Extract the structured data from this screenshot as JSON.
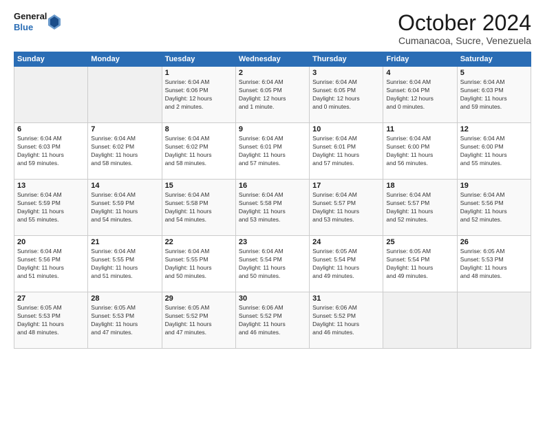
{
  "logo": {
    "general": "General",
    "blue": "Blue"
  },
  "title": "October 2024",
  "location": "Cumanacoa, Sucre, Venezuela",
  "days_header": [
    "Sunday",
    "Monday",
    "Tuesday",
    "Wednesday",
    "Thursday",
    "Friday",
    "Saturday"
  ],
  "weeks": [
    [
      {
        "day": "",
        "info": ""
      },
      {
        "day": "",
        "info": ""
      },
      {
        "day": "1",
        "info": "Sunrise: 6:04 AM\nSunset: 6:06 PM\nDaylight: 12 hours\nand 2 minutes."
      },
      {
        "day": "2",
        "info": "Sunrise: 6:04 AM\nSunset: 6:05 PM\nDaylight: 12 hours\nand 1 minute."
      },
      {
        "day": "3",
        "info": "Sunrise: 6:04 AM\nSunset: 6:05 PM\nDaylight: 12 hours\nand 0 minutes."
      },
      {
        "day": "4",
        "info": "Sunrise: 6:04 AM\nSunset: 6:04 PM\nDaylight: 12 hours\nand 0 minutes."
      },
      {
        "day": "5",
        "info": "Sunrise: 6:04 AM\nSunset: 6:03 PM\nDaylight: 11 hours\nand 59 minutes."
      }
    ],
    [
      {
        "day": "6",
        "info": "Sunrise: 6:04 AM\nSunset: 6:03 PM\nDaylight: 11 hours\nand 59 minutes."
      },
      {
        "day": "7",
        "info": "Sunrise: 6:04 AM\nSunset: 6:02 PM\nDaylight: 11 hours\nand 58 minutes."
      },
      {
        "day": "8",
        "info": "Sunrise: 6:04 AM\nSunset: 6:02 PM\nDaylight: 11 hours\nand 58 minutes."
      },
      {
        "day": "9",
        "info": "Sunrise: 6:04 AM\nSunset: 6:01 PM\nDaylight: 11 hours\nand 57 minutes."
      },
      {
        "day": "10",
        "info": "Sunrise: 6:04 AM\nSunset: 6:01 PM\nDaylight: 11 hours\nand 57 minutes."
      },
      {
        "day": "11",
        "info": "Sunrise: 6:04 AM\nSunset: 6:00 PM\nDaylight: 11 hours\nand 56 minutes."
      },
      {
        "day": "12",
        "info": "Sunrise: 6:04 AM\nSunset: 6:00 PM\nDaylight: 11 hours\nand 55 minutes."
      }
    ],
    [
      {
        "day": "13",
        "info": "Sunrise: 6:04 AM\nSunset: 5:59 PM\nDaylight: 11 hours\nand 55 minutes."
      },
      {
        "day": "14",
        "info": "Sunrise: 6:04 AM\nSunset: 5:59 PM\nDaylight: 11 hours\nand 54 minutes."
      },
      {
        "day": "15",
        "info": "Sunrise: 6:04 AM\nSunset: 5:58 PM\nDaylight: 11 hours\nand 54 minutes."
      },
      {
        "day": "16",
        "info": "Sunrise: 6:04 AM\nSunset: 5:58 PM\nDaylight: 11 hours\nand 53 minutes."
      },
      {
        "day": "17",
        "info": "Sunrise: 6:04 AM\nSunset: 5:57 PM\nDaylight: 11 hours\nand 53 minutes."
      },
      {
        "day": "18",
        "info": "Sunrise: 6:04 AM\nSunset: 5:57 PM\nDaylight: 11 hours\nand 52 minutes."
      },
      {
        "day": "19",
        "info": "Sunrise: 6:04 AM\nSunset: 5:56 PM\nDaylight: 11 hours\nand 52 minutes."
      }
    ],
    [
      {
        "day": "20",
        "info": "Sunrise: 6:04 AM\nSunset: 5:56 PM\nDaylight: 11 hours\nand 51 minutes."
      },
      {
        "day": "21",
        "info": "Sunrise: 6:04 AM\nSunset: 5:55 PM\nDaylight: 11 hours\nand 51 minutes."
      },
      {
        "day": "22",
        "info": "Sunrise: 6:04 AM\nSunset: 5:55 PM\nDaylight: 11 hours\nand 50 minutes."
      },
      {
        "day": "23",
        "info": "Sunrise: 6:04 AM\nSunset: 5:54 PM\nDaylight: 11 hours\nand 50 minutes."
      },
      {
        "day": "24",
        "info": "Sunrise: 6:05 AM\nSunset: 5:54 PM\nDaylight: 11 hours\nand 49 minutes."
      },
      {
        "day": "25",
        "info": "Sunrise: 6:05 AM\nSunset: 5:54 PM\nDaylight: 11 hours\nand 49 minutes."
      },
      {
        "day": "26",
        "info": "Sunrise: 6:05 AM\nSunset: 5:53 PM\nDaylight: 11 hours\nand 48 minutes."
      }
    ],
    [
      {
        "day": "27",
        "info": "Sunrise: 6:05 AM\nSunset: 5:53 PM\nDaylight: 11 hours\nand 48 minutes."
      },
      {
        "day": "28",
        "info": "Sunrise: 6:05 AM\nSunset: 5:53 PM\nDaylight: 11 hours\nand 47 minutes."
      },
      {
        "day": "29",
        "info": "Sunrise: 6:05 AM\nSunset: 5:52 PM\nDaylight: 11 hours\nand 47 minutes."
      },
      {
        "day": "30",
        "info": "Sunrise: 6:06 AM\nSunset: 5:52 PM\nDaylight: 11 hours\nand 46 minutes."
      },
      {
        "day": "31",
        "info": "Sunrise: 6:06 AM\nSunset: 5:52 PM\nDaylight: 11 hours\nand 46 minutes."
      },
      {
        "day": "",
        "info": ""
      },
      {
        "day": "",
        "info": ""
      }
    ]
  ]
}
